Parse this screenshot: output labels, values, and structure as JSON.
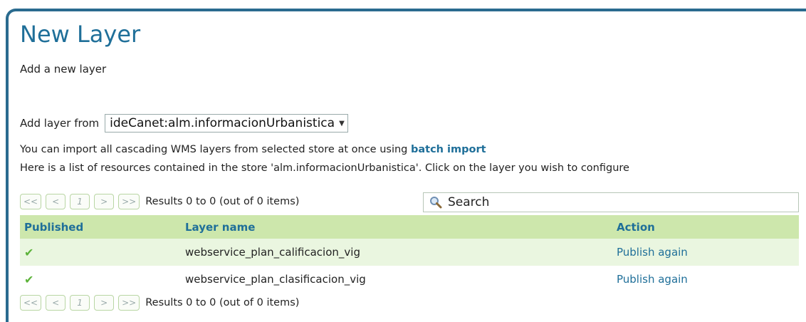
{
  "page": {
    "title": "New Layer",
    "subtitle": "Add a new layer"
  },
  "layer_from": {
    "label": "Add layer from",
    "selected": "ideCanet:alm.informacionUrbanistica"
  },
  "info": {
    "batch_prefix": "You can import all cascading WMS layers from selected store at once using ",
    "batch_link": "batch import",
    "list_text": "Here is a list of resources contained in the store 'alm.informacionUrbanistica'. Click on the layer you wish to configure"
  },
  "pager": {
    "first": "<<",
    "prev": "<",
    "page": "1",
    "next": ">",
    "last": ">>",
    "results": "Results 0 to 0 (out of 0 items)"
  },
  "search": {
    "placeholder": "Search",
    "icon": "magnifier-icon"
  },
  "table": {
    "headers": {
      "published": "Published",
      "layer_name": "Layer name",
      "action": "Action"
    },
    "rows": [
      {
        "published": true,
        "layer_name": "webservice_plan_calificacion_vig",
        "action": "Publish again"
      },
      {
        "published": true,
        "layer_name": "webservice_plan_clasificacion_vig",
        "action": "Publish again"
      }
    ]
  },
  "colors": {
    "accent": "#1f6f99",
    "header_bg": "#cde7ac",
    "row_alt_bg": "#eaf6e0",
    "check": "#5db33a"
  }
}
